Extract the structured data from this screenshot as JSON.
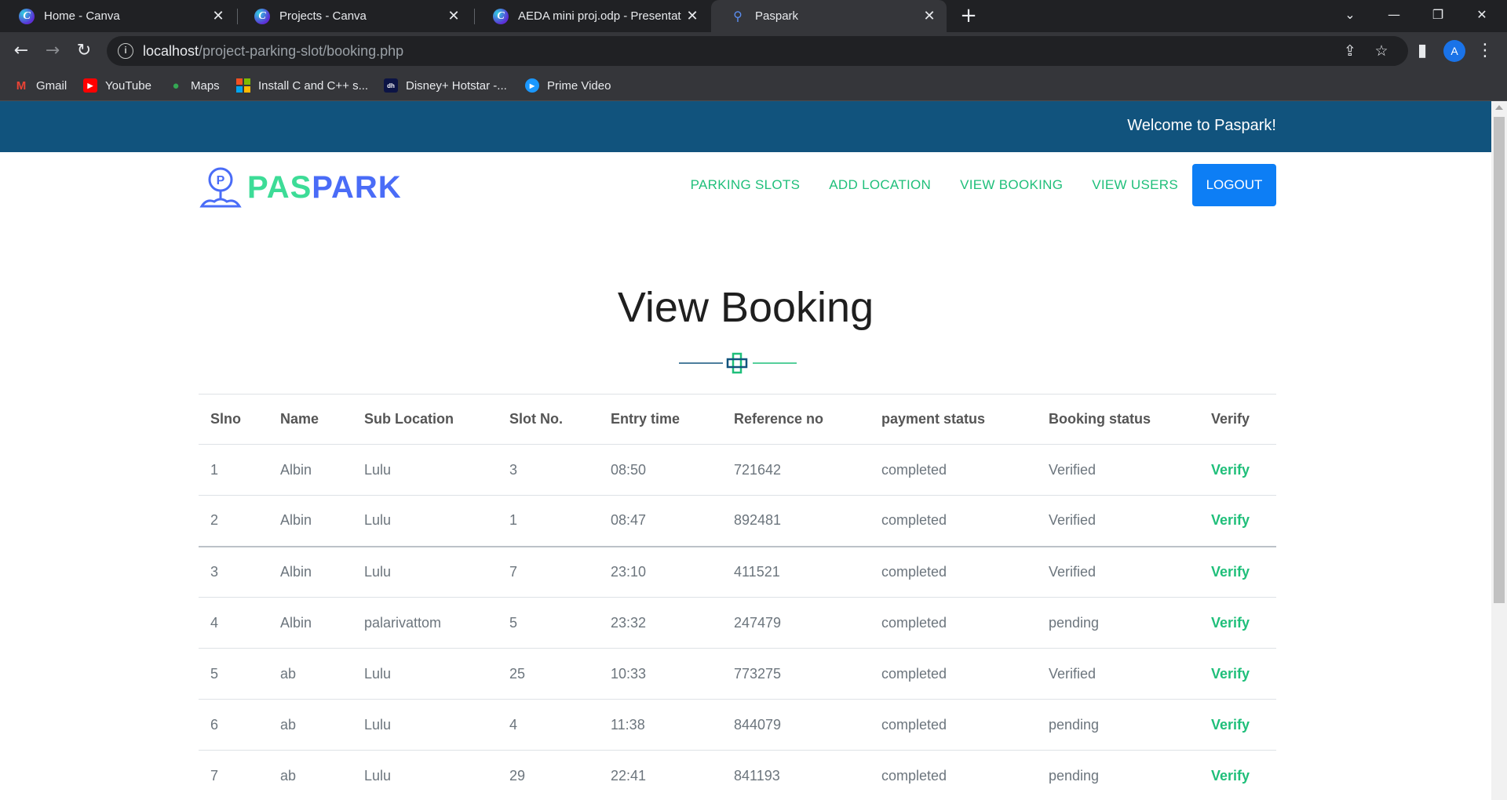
{
  "browser": {
    "tabs": [
      {
        "title": "Home - Canva",
        "icon": "canva-icon"
      },
      {
        "title": "Projects - Canva",
        "icon": "canva-icon"
      },
      {
        "title": "AEDA mini proj.odp - Presentatio",
        "icon": "canva-icon"
      },
      {
        "title": "Paspark",
        "icon": "location-pin-icon"
      }
    ],
    "url_host": "localhost",
    "url_path": "/project-parking-slot/booking.php",
    "profile_initial": "A",
    "bookmarks": [
      {
        "label": "Gmail",
        "icon": "gmail-icon"
      },
      {
        "label": "YouTube",
        "icon": "youtube-icon"
      },
      {
        "label": "Maps",
        "icon": "maps-icon"
      },
      {
        "label": "Install C and C++ s...",
        "icon": "microsoft-icon"
      },
      {
        "label": "Disney+ Hotstar -...",
        "icon": "hotstar-icon"
      },
      {
        "label": "Prime Video",
        "icon": "prime-video-icon"
      }
    ]
  },
  "site": {
    "welcome": "Welcome to Paspark!",
    "logo_part1": "PAS",
    "logo_part2": "PARK",
    "nav": {
      "parking_slots": "PARKING SLOTS",
      "add_location": "ADD LOCATION",
      "view_booking": "VIEW BOOKING",
      "view_users": "VIEW USERS",
      "logout": "LOGOUT"
    },
    "accent_green": "#1fbf7a",
    "accent_blue": "#0d7ef5",
    "topbar_color": "#11537d"
  },
  "main": {
    "title": "View Booking",
    "table": {
      "headers": [
        "Slno",
        "Name",
        "Sub Location",
        "Slot No.",
        "Entry time",
        "Reference no",
        "payment status",
        "Booking status",
        "Verify"
      ],
      "rows": [
        {
          "slno": "1",
          "name": "Albin",
          "sub_location": "Lulu",
          "slot": "3",
          "entry": "08:50",
          "ref": "721642",
          "payment": "completed",
          "booking": "Verified",
          "verify": "Verify"
        },
        {
          "slno": "2",
          "name": "Albin",
          "sub_location": "Lulu",
          "slot": "1",
          "entry": "08:47",
          "ref": "892481",
          "payment": "completed",
          "booking": "Verified",
          "verify": "Verify"
        },
        {
          "slno": "3",
          "name": "Albin",
          "sub_location": "Lulu",
          "slot": "7",
          "entry": "23:10",
          "ref": "411521",
          "payment": "completed",
          "booking": "Verified",
          "verify": "Verify"
        },
        {
          "slno": "4",
          "name": "Albin",
          "sub_location": "palarivattom",
          "slot": "5",
          "entry": "23:32",
          "ref": "247479",
          "payment": "completed",
          "booking": "pending",
          "verify": "Verify"
        },
        {
          "slno": "5",
          "name": "ab",
          "sub_location": "Lulu",
          "slot": "25",
          "entry": "10:33",
          "ref": "773275",
          "payment": "completed",
          "booking": "Verified",
          "verify": "Verify"
        },
        {
          "slno": "6",
          "name": "ab",
          "sub_location": "Lulu",
          "slot": "4",
          "entry": "11:38",
          "ref": "844079",
          "payment": "completed",
          "booking": "pending",
          "verify": "Verify"
        },
        {
          "slno": "7",
          "name": "ab",
          "sub_location": "Lulu",
          "slot": "29",
          "entry": "22:41",
          "ref": "841193",
          "payment": "completed",
          "booking": "pending",
          "verify": "Verify"
        }
      ]
    }
  }
}
